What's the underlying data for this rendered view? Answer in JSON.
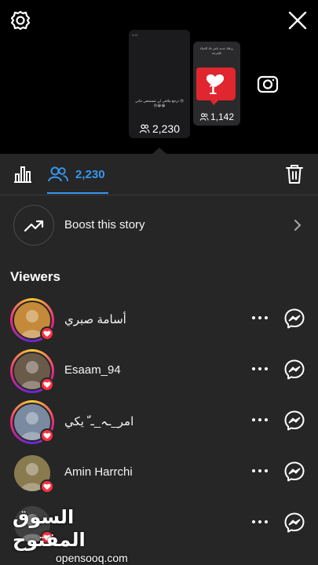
{
  "header": {
    "settings_icon": "gear-icon",
    "close_icon": "close-icon",
    "camera_icon": "camera-icon"
  },
  "stories": {
    "current": {
      "views": "2,230",
      "mini_header_left": "9:41",
      "mini_header_right": "",
      "caption": "ترجع تتلاقى لي تستمتعي تتاني\n😢😢😭😭"
    },
    "previous": {
      "views": "1,142",
      "caption": "رزقك جديد باش تك الحياة بالفرحة"
    },
    "like_count": "1"
  },
  "tabs": {
    "viewers_count": "2,230",
    "accent_color": "#3797f0"
  },
  "boost": {
    "label": "Boost this story"
  },
  "viewers": {
    "title": "Viewers",
    "items": [
      {
        "name": "أسامة صبري",
        "liked": true,
        "ring": true,
        "avatar_color": "#c48a3a"
      },
      {
        "name": "Esaam_94",
        "liked": true,
        "ring": true,
        "avatar_color": "#6a5a4a"
      },
      {
        "name": "امر_ـہ_ـ ّ يكي",
        "liked": true,
        "ring": true,
        "avatar_color": "#7a8aa0"
      },
      {
        "name": "Amin Harrchi",
        "liked": true,
        "ring": false,
        "avatar_color": "#8a7a50"
      },
      {
        "name": "",
        "liked": true,
        "ring": false,
        "avatar_color": "#404040"
      }
    ]
  },
  "watermark": {
    "arabic": "السوق المفتوح",
    "latin": "opensooq.com"
  }
}
